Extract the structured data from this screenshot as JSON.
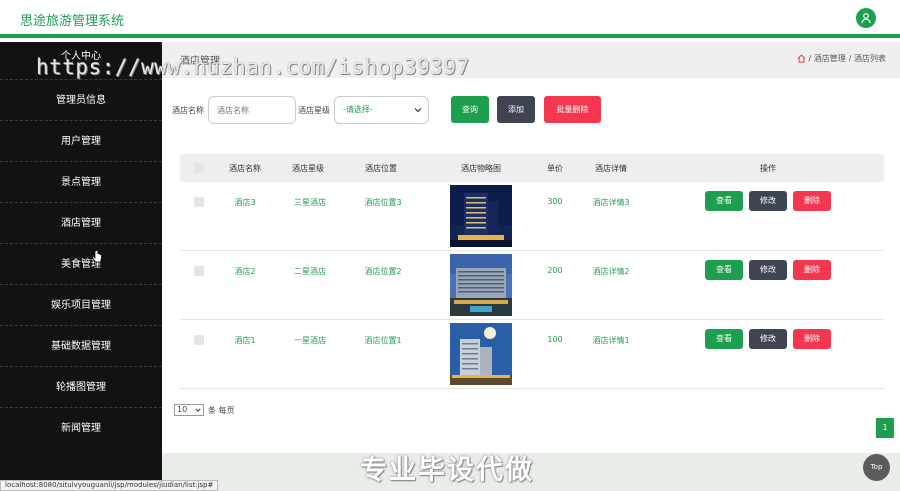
{
  "header": {
    "title": "思途旅游管理系统",
    "user_icon": "user-icon"
  },
  "sidebar": {
    "items": [
      {
        "label": "个人中心"
      },
      {
        "label": "管理员信息"
      },
      {
        "label": "用户管理"
      },
      {
        "label": "景点管理"
      },
      {
        "label": "酒店管理"
      },
      {
        "label": "美食管理"
      },
      {
        "label": "娱乐项目管理"
      },
      {
        "label": "基础数据管理"
      },
      {
        "label": "轮播图管理"
      },
      {
        "label": "新闻管理"
      }
    ]
  },
  "breadcrumb": {
    "title": "酒店管理",
    "path1": "/ 酒店管理",
    "path2": "/ 酒店列表"
  },
  "filter": {
    "name_label": "酒店名称",
    "name_placeholder": "酒店名称",
    "grade_label": "酒店星级",
    "grade_value": "-请选择-",
    "query": "查询",
    "add": "添加",
    "batch_delete": "批量删除"
  },
  "table": {
    "headers": [
      "酒店名称",
      "酒店星级",
      "酒店位置",
      "酒店物略图",
      "单价",
      "酒店详情",
      "操作"
    ],
    "rows": [
      {
        "name": "酒店3",
        "grade": "三星酒店",
        "location": "酒店位置3",
        "price": "300",
        "detail": "酒店详情3"
      },
      {
        "name": "酒店2",
        "grade": "二星酒店",
        "location": "酒店位置2",
        "price": "200",
        "detail": "酒店详情2"
      },
      {
        "name": "酒店1",
        "grade": "一星酒店",
        "location": "酒店位置1",
        "price": "100",
        "detail": "酒店详情1"
      }
    ],
    "actions": {
      "view": "查看",
      "edit": "修改",
      "delete": "删除"
    }
  },
  "pager": {
    "size": "10",
    "suffix": "条 每页",
    "page": "1"
  },
  "overlay": {
    "watermark_top": "https://www.huzhan.com/ishop39397",
    "watermark_bottom": "专业毕设代做",
    "top_button": "Top",
    "status_url": "localhost:8080/situlvyouguanli/jsp/modules/jiudian/list.jsp#"
  },
  "colors": {
    "accent": "#1e9f4f",
    "dark": "#3e4452",
    "danger": "#f5364f",
    "sidebar": "#121212"
  }
}
